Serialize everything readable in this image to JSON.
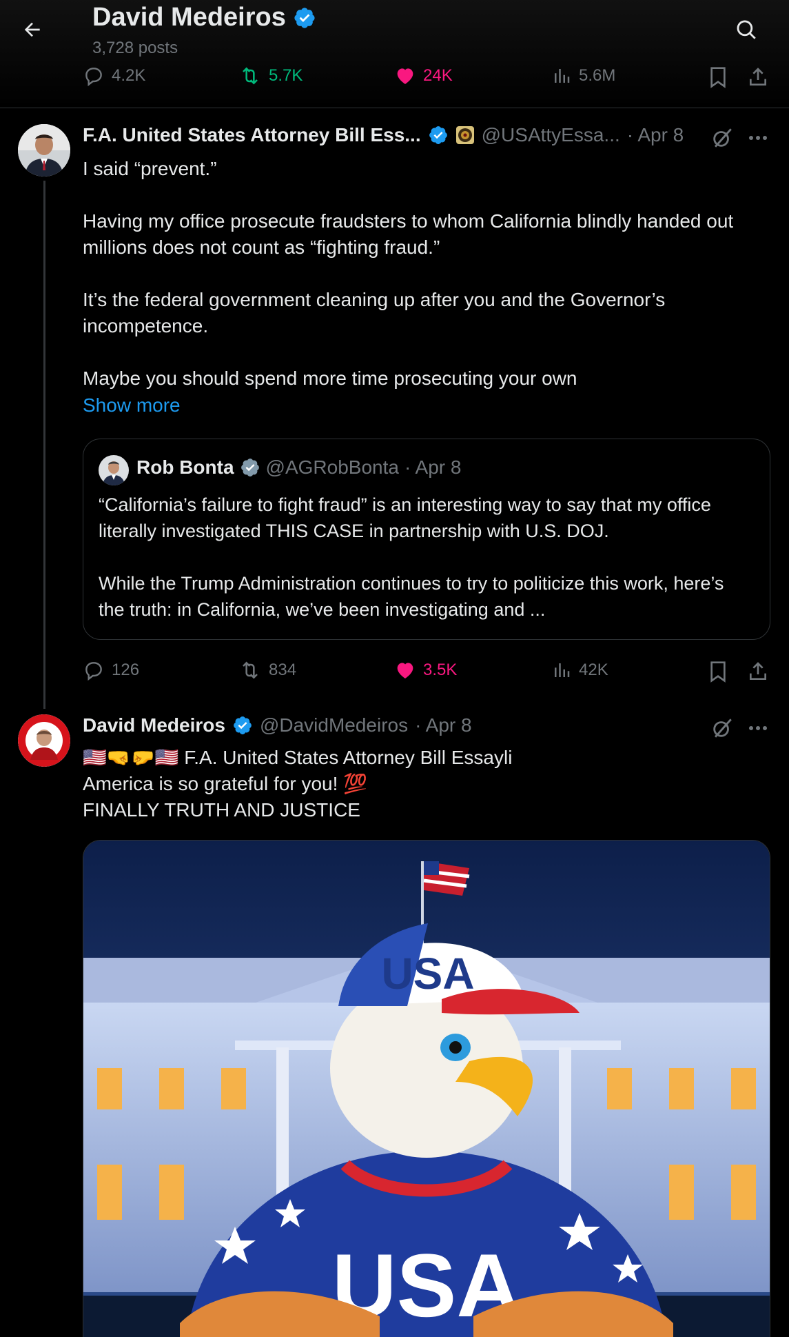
{
  "header": {
    "title": "David Medeiros",
    "posts_count": "3,728 posts",
    "back_icon": "arrow-left-icon",
    "search_icon": "search-icon",
    "stats": {
      "replies": "4.2K",
      "reposts": "5.7K",
      "likes": "24K",
      "views": "5.6M"
    }
  },
  "post1": {
    "name": "F.A. United States Attorney Bill Ess...",
    "handle": "@USAttyEssa...",
    "time": "· Apr 8",
    "text": "I said “prevent.”\n\nHaving my office prosecute fraudsters to whom California blindly handed out millions does not count as “fighting fraud.”\n\nIt’s the federal government cleaning up after you and the Governor’s incompetence.\n\nMaybe you should spend more time prosecuting your own",
    "show_more": "Show more",
    "quote": {
      "name": "Rob Bonta",
      "handle": "@AGRobBonta",
      "time": "· Apr 8",
      "text": "“California’s failure to fight fraud” is an interesting way to say that my office literally investigated THIS CASE in partnership with U.S. DOJ.\n\nWhile the Trump Administration continues to try to politicize this work, here’s the truth: in California, we’ve been investigating and ..."
    },
    "stats": {
      "replies": "126",
      "reposts": "834",
      "likes": "3.5K",
      "views": "42K"
    }
  },
  "post2": {
    "name": "David Medeiros",
    "handle": "@DavidMedeiros",
    "time": "· Apr 8",
    "line1": "🇺🇸🤜🤛🇺🇸  F.A. United States Attorney Bill Essayli",
    "line2": "America is so grateful for you! 💯",
    "line3": "FINALLY TRUTH AND JUSTICE",
    "image_text_cap": "USA",
    "image_text_shirt": "USA"
  },
  "colors": {
    "background": "#000000",
    "text": "#e7e9ea",
    "muted": "#71767b",
    "accent_blue": "#1d9bf0",
    "repost_green": "#00ba7c",
    "like_pink": "#f91880"
  }
}
